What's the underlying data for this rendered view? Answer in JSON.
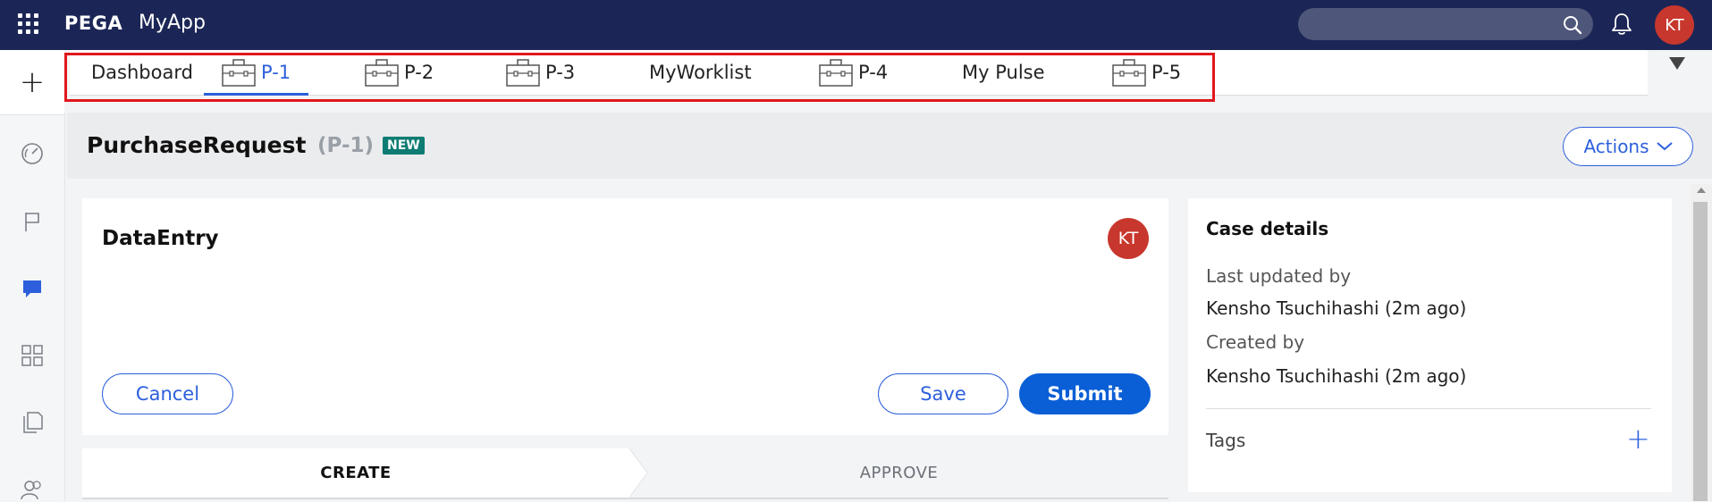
{
  "header": {
    "brand": "PEGA",
    "app_name": "MyApp",
    "user_initials": "KT",
    "icons": [
      "app-grid-icon",
      "search-icon",
      "bell-icon"
    ]
  },
  "tabs": [
    {
      "label": "Dashboard",
      "case_icon": false,
      "active": false
    },
    {
      "label": "P-1",
      "case_icon": true,
      "active": true
    },
    {
      "label": "P-2",
      "case_icon": true,
      "active": false
    },
    {
      "label": "P-3",
      "case_icon": true,
      "active": false
    },
    {
      "label": "MyWorklist",
      "case_icon": false,
      "active": false
    },
    {
      "label": "P-4",
      "case_icon": true,
      "active": false
    },
    {
      "label": "My Pulse",
      "case_icon": false,
      "active": false
    },
    {
      "label": "P-5",
      "case_icon": true,
      "active": false
    }
  ],
  "left_rail": {
    "items": [
      "plus-icon",
      "gauge-icon",
      "flag-icon",
      "chat-icon",
      "apps-icon",
      "documents-icon",
      "people-icon"
    ]
  },
  "case": {
    "title": "PurchaseRequest",
    "id": "(P-1)",
    "status_badge": "NEW",
    "actions_label": "Actions"
  },
  "main_panel": {
    "title": "DataEntry",
    "assignee_initials": "KT",
    "cancel_label": "Cancel",
    "save_label": "Save",
    "submit_label": "Submit"
  },
  "stages": [
    {
      "label": "CREATE",
      "current": true
    },
    {
      "label": "APPROVE",
      "current": false
    }
  ],
  "details": {
    "heading": "Case details",
    "last_updated_label": "Last updated by",
    "last_updated_value": "Kensho Tsuchihashi (2m ago)",
    "created_label": "Created by",
    "created_value": "Kensho Tsuchihashi (2m ago)",
    "tags_label": "Tags"
  },
  "colors": {
    "header_bg": "#1c2656",
    "accent": "#2d5fdc",
    "primary_button": "#0a5fd6",
    "avatar": "#c8372d",
    "new_badge": "#0e7c72",
    "highlight": "#e0171c"
  }
}
